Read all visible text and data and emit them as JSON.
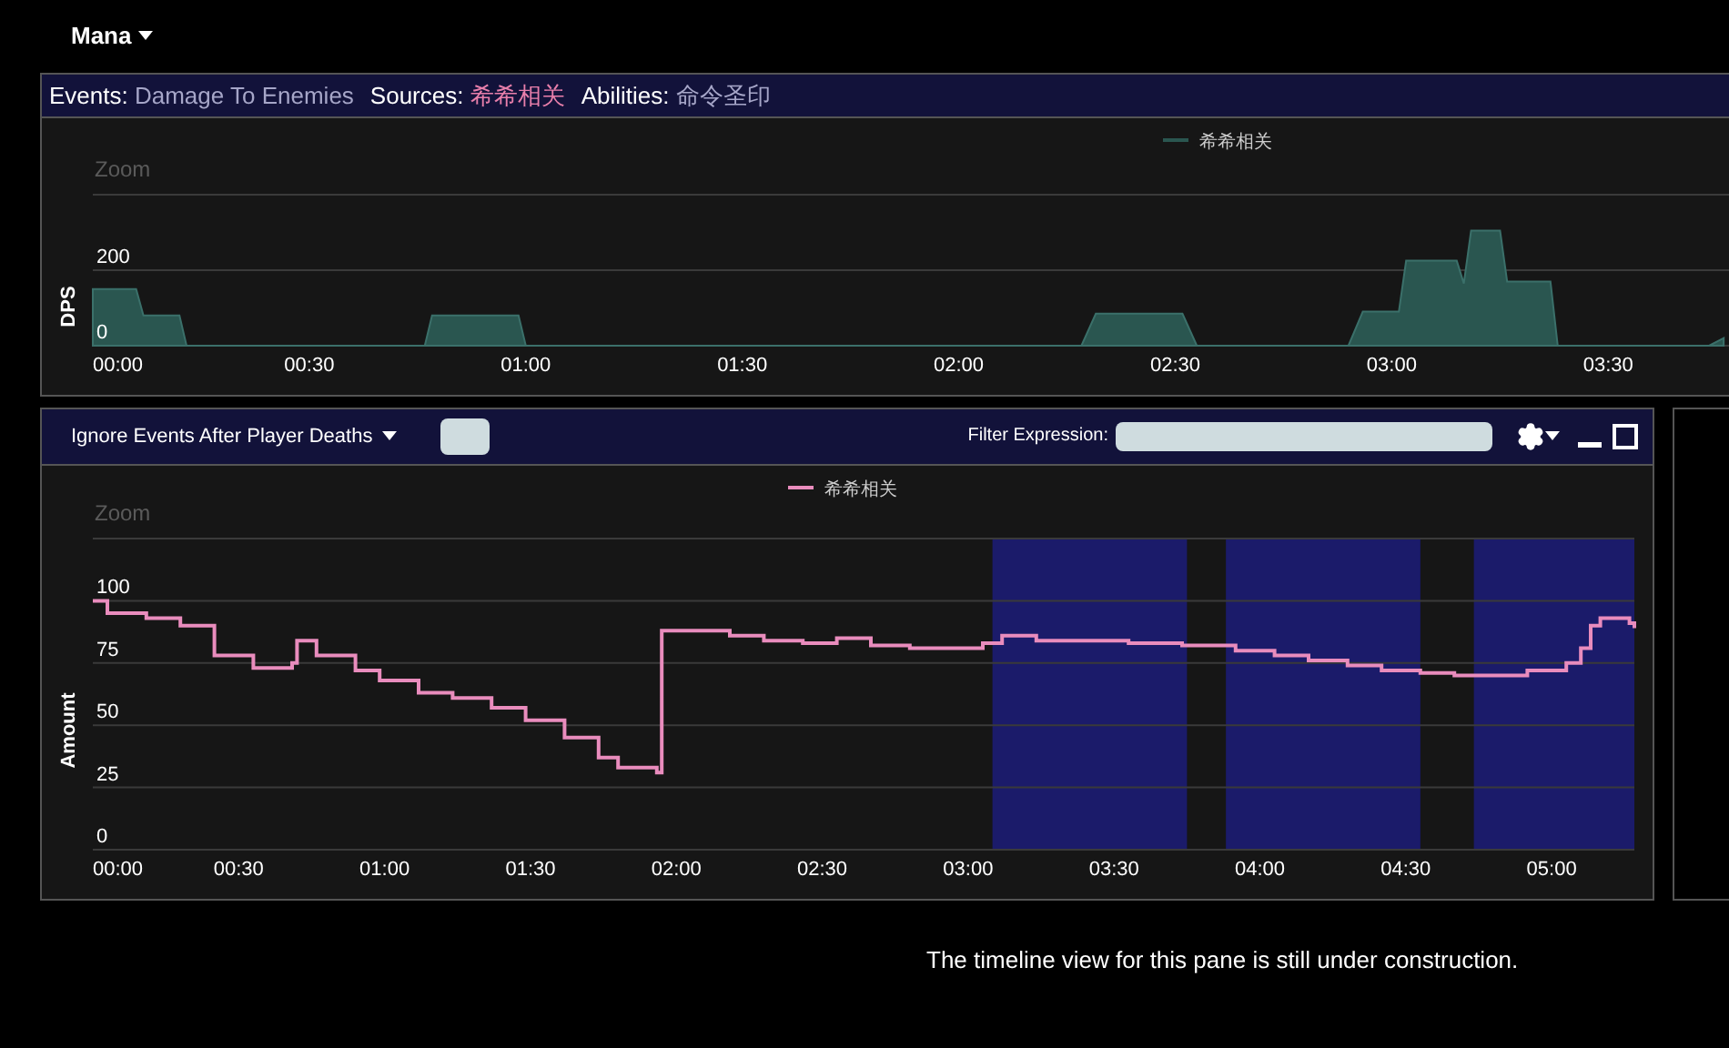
{
  "top_menu": {
    "label": "Mana"
  },
  "damage_pane": {
    "filters": [
      {
        "label": "Events:",
        "value": "Damage To Enemies",
        "color": "#a6a6c8"
      },
      {
        "label": "Sources:",
        "value": "希希相关",
        "color": "#e87fab"
      },
      {
        "label": "Abilities:",
        "value": "命令圣印",
        "color": "#a6a6c8"
      }
    ],
    "zoom_label": "Zoom",
    "chart_data": {
      "type": "area",
      "ylabel": "DPS",
      "xlim": [
        0,
        228
      ],
      "ylim": [
        0,
        400
      ],
      "grid": true,
      "x": [
        0,
        6,
        7,
        12,
        13,
        46,
        47,
        59,
        60,
        137,
        139,
        151,
        153,
        174,
        176,
        181,
        182,
        189,
        190,
        191,
        195,
        196,
        202,
        203,
        224,
        226
      ],
      "series": [
        {
          "name": "希希相关",
          "color": "#2a5650",
          "values": [
            150,
            150,
            80,
            80,
            0,
            0,
            80,
            80,
            0,
            0,
            85,
            85,
            0,
            0,
            90,
            90,
            225,
            225,
            165,
            305,
            305,
            170,
            170,
            0,
            0,
            20
          ]
        }
      ],
      "xticks": [
        {
          "value": 0,
          "label": "00:00"
        },
        {
          "value": 30,
          "label": "00:30"
        },
        {
          "value": 60,
          "label": "01:00"
        },
        {
          "value": 90,
          "label": "01:30"
        },
        {
          "value": 120,
          "label": "02:00"
        },
        {
          "value": 150,
          "label": "02:30"
        },
        {
          "value": 180,
          "label": "03:00"
        },
        {
          "value": 210,
          "label": "03:30"
        }
      ],
      "yticks": [
        0,
        200
      ]
    }
  },
  "resource_pane": {
    "death_filter": "Ignore Events After Player Deaths",
    "filter_label": "Filter Expression:",
    "zoom_label": "Zoom",
    "chart_data": {
      "type": "line",
      "ylabel": "Amount",
      "xlim": [
        0,
        317
      ],
      "ylim": [
        0,
        125
      ],
      "grid": true,
      "x": [
        0,
        3,
        3,
        11,
        11,
        18,
        18,
        25,
        25,
        33,
        33,
        41,
        41,
        42,
        42,
        46,
        46,
        54,
        54,
        59,
        59,
        67,
        67,
        74,
        74,
        82,
        82,
        89,
        89,
        97,
        97,
        104,
        104,
        108,
        108,
        116,
        116,
        117,
        117,
        123,
        123,
        131,
        131,
        138,
        138,
        146,
        146,
        153,
        153,
        160,
        160,
        168,
        168,
        175,
        175,
        183,
        183,
        187,
        187,
        194,
        194,
        205,
        205,
        213,
        213,
        224,
        224,
        235,
        235,
        243,
        243,
        250,
        250,
        258,
        258,
        265,
        265,
        273,
        273,
        280,
        280,
        288,
        288,
        295,
        295,
        303,
        303,
        306,
        306,
        308,
        308,
        310,
        310,
        316,
        316,
        317,
        317
      ],
      "series": [
        {
          "name": "希希相关",
          "color": "#e98cbd",
          "values": [
            100,
            100,
            95,
            95,
            93,
            93,
            90,
            90,
            78,
            78,
            73,
            73,
            75,
            75,
            84,
            84,
            78,
            78,
            72,
            72,
            68,
            68,
            63,
            63,
            61,
            61,
            57,
            57,
            52,
            52,
            45,
            45,
            37,
            37,
            33,
            33,
            31,
            31,
            88,
            88,
            88,
            88,
            86,
            86,
            84,
            84,
            83,
            83,
            85,
            85,
            82,
            82,
            81,
            81,
            81,
            81,
            83,
            83,
            86,
            86,
            84,
            84,
            84,
            84,
            83,
            83,
            82,
            82,
            80,
            80,
            78,
            78,
            76,
            76,
            74,
            74,
            72,
            72,
            71,
            71,
            70,
            70,
            70,
            70,
            72,
            72,
            75,
            75,
            81,
            81,
            90,
            90,
            93,
            93,
            91,
            91,
            89
          ]
        }
      ],
      "xticks": [
        {
          "value": 0,
          "label": "00:00"
        },
        {
          "value": 30,
          "label": "00:30"
        },
        {
          "value": 60,
          "label": "01:00"
        },
        {
          "value": 90,
          "label": "01:30"
        },
        {
          "value": 120,
          "label": "02:00"
        },
        {
          "value": 150,
          "label": "02:30"
        },
        {
          "value": 180,
          "label": "03:00"
        },
        {
          "value": 210,
          "label": "03:30"
        },
        {
          "value": 240,
          "label": "04:00"
        },
        {
          "value": 270,
          "label": "04:30"
        },
        {
          "value": 300,
          "label": "05:00"
        }
      ],
      "yticks": [
        0,
        25,
        50,
        75,
        100
      ],
      "bands": [
        {
          "axis": "x",
          "from": 185,
          "to": 225
        },
        {
          "axis": "x",
          "from": 233,
          "to": 273
        },
        {
          "axis": "x",
          "from": 284,
          "to": 317
        }
      ]
    }
  },
  "footer": "The timeline view for this pane is still under construction."
}
